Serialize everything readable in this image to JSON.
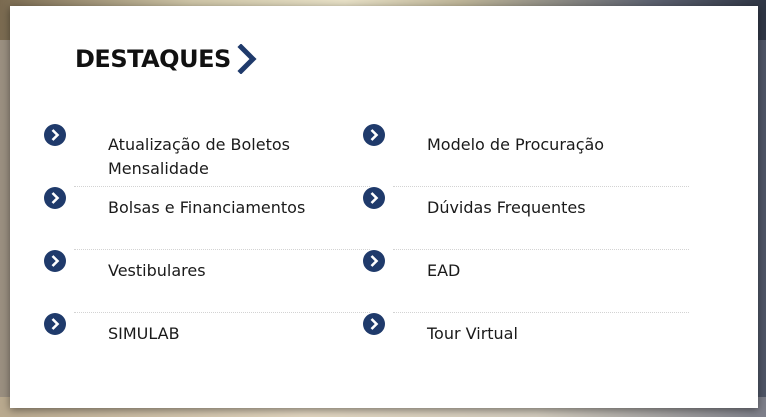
{
  "header": {
    "title": "DESTAQUES"
  },
  "colors": {
    "accent": "#1f3a6b",
    "text": "#1a1a1a"
  },
  "items_left": [
    {
      "label": "Atualização de Boletos Mensalidade",
      "icon": "chevron-circle-icon"
    },
    {
      "label": "Bolsas e Financiamentos",
      "icon": "chevron-circle-icon"
    },
    {
      "label": "Vestibulares",
      "icon": "chevron-circle-icon"
    },
    {
      "label": "SIMULAB",
      "icon": "chevron-circle-icon"
    }
  ],
  "items_right": [
    {
      "label": "Modelo de Procuração",
      "icon": "chevron-circle-icon"
    },
    {
      "label": "Dúvidas Frequentes",
      "icon": "chevron-circle-icon"
    },
    {
      "label": "EAD",
      "icon": "chevron-circle-icon"
    },
    {
      "label": "Tour Virtual",
      "icon": "chevron-circle-icon"
    }
  ]
}
